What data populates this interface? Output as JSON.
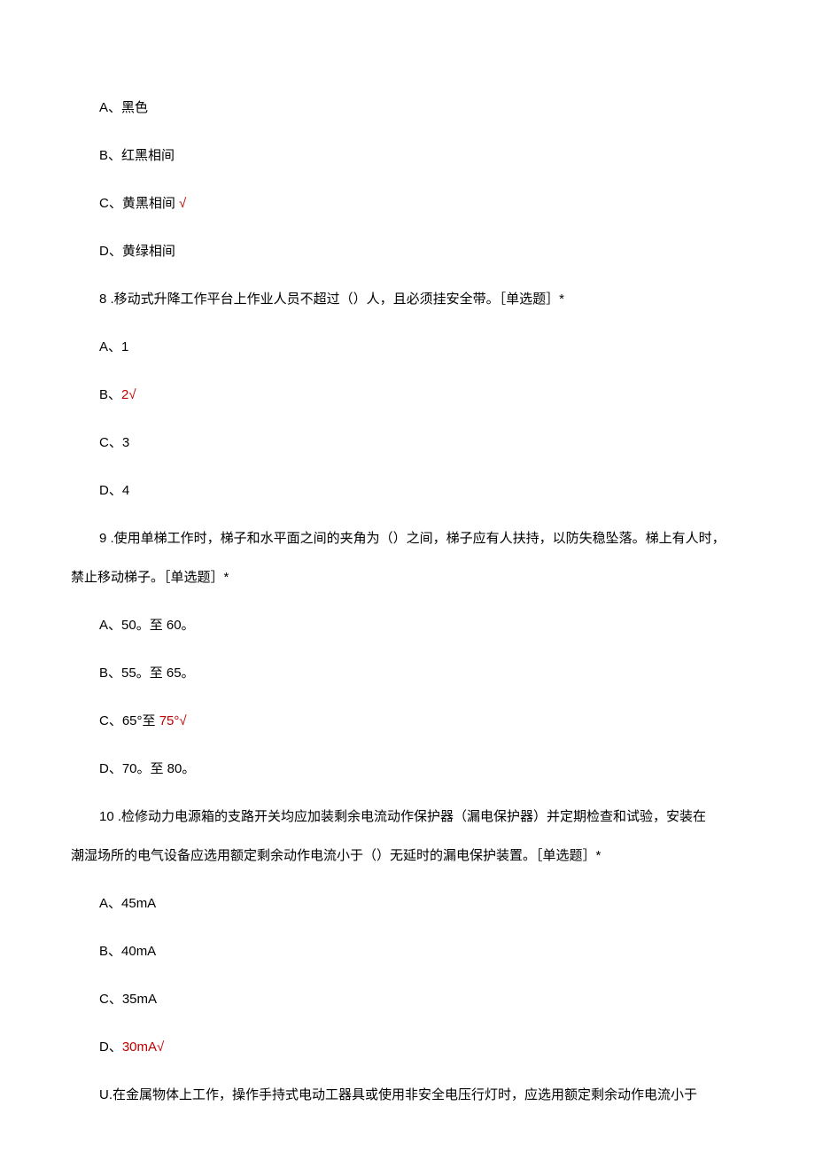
{
  "q7_options": {
    "a": "A、黑色",
    "b": "B、红黑相间",
    "c_prefix": "C、黄黑相间 ",
    "c_mark": "√",
    "d": "D、黄绿相间"
  },
  "q8": {
    "text": "8  .移动式升降工作平台上作业人员不超过（）人，且必须挂安全带。［单选题］*",
    "a": "A、1",
    "b_prefix": "B、",
    "b_answer": "2√",
    "c": "C、3",
    "d": "D、4"
  },
  "q9": {
    "text1": "9  .使用单梯工作时，梯子和水平面之间的夹角为（）之间，梯子应有人扶持，以防失稳坠落。梯上有人时，",
    "text2": "禁止移动梯子。［单选题］*",
    "a": "A、50。至 60。",
    "b": "B、55。至 65。",
    "c_prefix": "C、65°至 ",
    "c_answer": "75°√",
    "d": "D、70。至 80。"
  },
  "q10": {
    "text1": "10  .检修动力电源箱的支路开关均应加装剩余电流动作保护器（漏电保护器）并定期检查和试验，安装在",
    "text2": "潮湿场所的电气设备应选用额定剩余动作电流小于（）无延时的漏电保护装置。［单选题］*",
    "a": "A、45mA",
    "b": "B、40mA",
    "c": "C、35mA",
    "d_prefix": "D、",
    "d_answer": "30mA√"
  },
  "q11": {
    "text": "U.在金属物体上工作，操作手持式电动工器具或使用非安全电压行灯时，应选用额定剩余动作电流小于"
  }
}
